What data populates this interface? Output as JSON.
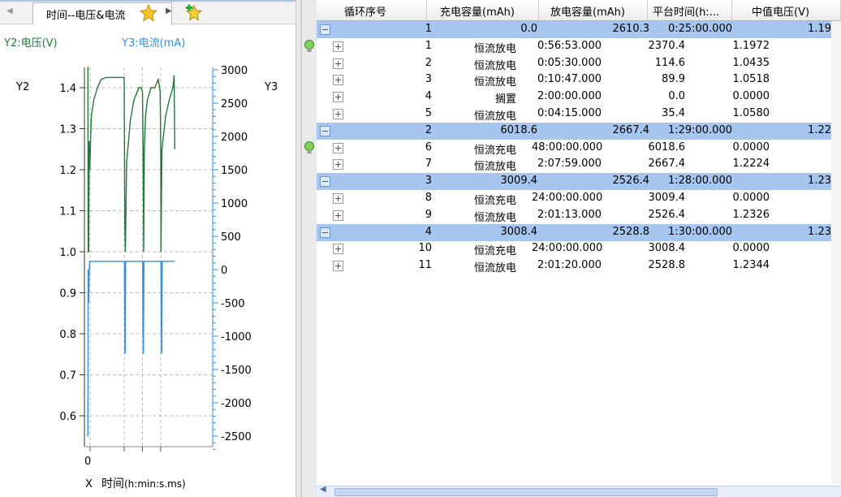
{
  "left_tabs": {
    "active_label": "时间--电压&电流"
  },
  "chart_meta": {
    "y2_legend": "Y2:电压(V)",
    "y3_legend": "Y3:电流(mA)",
    "y2_axis_name": "Y2",
    "y3_axis_name": "Y3",
    "x_axis_name": "X",
    "x_axis_label": "时间",
    "x_axis_unit": "(h:min:s.ms)",
    "x_tick": "0",
    "voltage_color": "#1f7a3c",
    "current_color": "#2f8fe0"
  },
  "chart_data": {
    "type": "line",
    "xlabel": "时间(h:min:s.ms)",
    "y2_ticks": [
      "1.4",
      "1.3",
      "1.2",
      "1.1",
      "1.0",
      "0.9",
      "0.8",
      "0.7",
      "0.6"
    ],
    "y3_ticks": [
      "3000",
      "2500",
      "2000",
      "1500",
      "1000",
      "500",
      "0",
      "-500",
      "-1000",
      "-1500",
      "-2000",
      "-2500"
    ],
    "y2_range": [
      0.55,
      1.45
    ],
    "y3_range": [
      -2700,
      3000
    ],
    "x_range": [
      0,
      1
    ],
    "grid": true,
    "series": [
      {
        "name": "电压(V)",
        "axis": "y2",
        "color": "#1f7a3c",
        "x": [
          0,
          0.002,
          0.004,
          0.008,
          0.012,
          0.016,
          0.018,
          0.022,
          0.03,
          0.05,
          0.08,
          0.11,
          0.15,
          0.2,
          0.25,
          0.28,
          0.3,
          0.305,
          0.31,
          0.312,
          0.32,
          0.33,
          0.35,
          0.38,
          0.42,
          0.44,
          0.45,
          0.455,
          0.46,
          0.465,
          0.475,
          0.49,
          0.52,
          0.55,
          0.58,
          0.595,
          0.6,
          0.602,
          0.61,
          0.64,
          0.67,
          0.7,
          0.71,
          0.715
        ],
        "y": [
          1.45,
          1.45,
          1.0,
          1.0,
          1.27,
          1.22,
          1.2,
          1.25,
          1.33,
          1.37,
          1.4,
          1.42,
          1.425,
          1.425,
          1.425,
          1.425,
          1.425,
          1.05,
          1.0,
          1.05,
          1.22,
          1.25,
          1.32,
          1.37,
          1.4,
          1.4,
          1.39,
          1.25,
          1.0,
          1.25,
          1.33,
          1.37,
          1.4,
          1.4,
          1.42,
          1.39,
          1.25,
          1.0,
          1.25,
          1.33,
          1.37,
          1.4,
          1.43,
          1.25
        ]
      },
      {
        "name": "电流(mA)",
        "axis": "y3",
        "color": "#2f8fe0",
        "x": [
          0,
          0.002,
          0.004,
          0.008,
          0.012,
          0.014,
          0.016,
          0.02,
          0.1,
          0.2,
          0.3,
          0.302,
          0.306,
          0.308,
          0.312,
          0.44,
          0.45,
          0.452,
          0.456,
          0.458,
          0.462,
          0.6,
          0.602,
          0.606,
          0.608,
          0.612,
          0.715
        ],
        "y": [
          -2500,
          -2500,
          0,
          -500,
          0,
          0,
          125,
          125,
          125,
          125,
          125,
          125,
          -1250,
          -1250,
          125,
          125,
          125,
          125,
          -1250,
          -1250,
          125,
          125,
          125,
          -1250,
          -1250,
          125,
          125
        ]
      }
    ]
  },
  "grid_header": [
    "循环序号",
    "充电容量(mAh)",
    "放电容量(mAh)",
    "平台时间(h:...",
    "中值电压(V)"
  ],
  "grid_rows": [
    {
      "type": "parent",
      "cols": [
        "1",
        "0.0",
        "2610.3",
        "0:25:00.000",
        "1.19"
      ]
    },
    {
      "type": "child",
      "cols": [
        "1",
        "恒流放电",
        "0:56:53.000",
        "2370.4",
        "1.1972"
      ],
      "bulb": true
    },
    {
      "type": "child",
      "cols": [
        "2",
        "恒流放电",
        "0:05:30.000",
        "114.6",
        "1.0435"
      ]
    },
    {
      "type": "child",
      "cols": [
        "3",
        "恒流放电",
        "0:10:47.000",
        "89.9",
        "1.0518"
      ]
    },
    {
      "type": "child",
      "cols": [
        "4",
        "搁置",
        "2:00:00.000",
        "0.0",
        "0.0000"
      ]
    },
    {
      "type": "child",
      "cols": [
        "5",
        "恒流放电",
        "0:04:15.000",
        "35.4",
        "1.0580"
      ]
    },
    {
      "type": "parent",
      "cols": [
        "2",
        "6018.6",
        "2667.4",
        "1:29:00.000",
        "1.22"
      ]
    },
    {
      "type": "child",
      "cols": [
        "6",
        "恒流充电",
        "48:00:00.000",
        "6018.6",
        "0.0000"
      ],
      "bulb": true
    },
    {
      "type": "child",
      "cols": [
        "7",
        "恒流放电",
        "2:07:59.000",
        "2667.4",
        "1.2224"
      ]
    },
    {
      "type": "parent",
      "cols": [
        "3",
        "3009.4",
        "2526.4",
        "1:28:00.000",
        "1.23"
      ]
    },
    {
      "type": "child",
      "cols": [
        "8",
        "恒流充电",
        "24:00:00.000",
        "3009.4",
        "0.0000"
      ]
    },
    {
      "type": "child",
      "cols": [
        "9",
        "恒流放电",
        "2:01:13.000",
        "2526.4",
        "1.2326"
      ]
    },
    {
      "type": "parent",
      "cols": [
        "4",
        "3008.4",
        "2528.8",
        "1:30:00.000",
        "1.23"
      ]
    },
    {
      "type": "child",
      "cols": [
        "10",
        "恒流充电",
        "24:00:00.000",
        "3008.4",
        "0.0000"
      ]
    },
    {
      "type": "child",
      "cols": [
        "11",
        "恒流放电",
        "2:01:20.000",
        "2528.8",
        "1.2344"
      ]
    }
  ]
}
